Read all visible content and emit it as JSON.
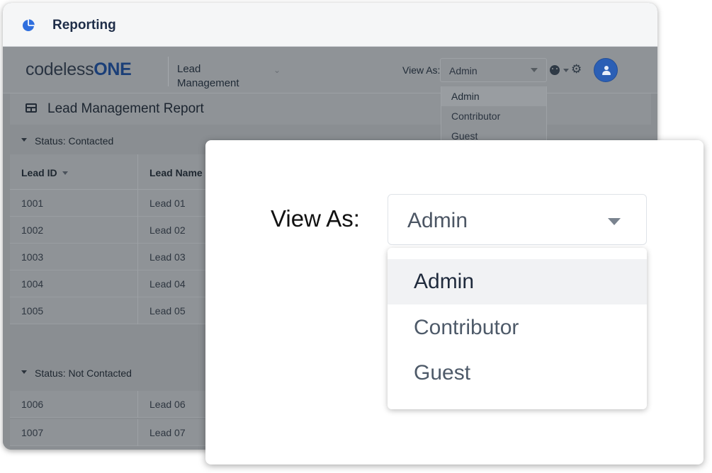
{
  "window": {
    "title": "Reporting",
    "app_icon": "pie-chart-icon"
  },
  "topbar": {
    "logo_main": "codeless",
    "logo_accent": "ONE",
    "app_selector": "Lead Management",
    "view_as_label": "View As:",
    "view_as_value": "Admin",
    "view_as_options": [
      "Admin",
      "Contributor",
      "Guest"
    ],
    "icons": [
      "smiley-icon",
      "gear-icon",
      "user-avatar-icon"
    ]
  },
  "report": {
    "title": "Lead Management Report",
    "columns": [
      "Lead ID",
      "Lead Name"
    ],
    "groups": [
      {
        "label": "Status: Contacted",
        "rows": [
          {
            "id": "1001",
            "name": "Lead 01"
          },
          {
            "id": "1002",
            "name": "Lead 02"
          },
          {
            "id": "1003",
            "name": "Lead 03"
          },
          {
            "id": "1004",
            "name": "Lead 04"
          },
          {
            "id": "1005",
            "name": "Lead 05"
          }
        ]
      },
      {
        "label": "Status: Not Contacted",
        "rows": [
          {
            "id": "1006",
            "name": "Lead 06"
          },
          {
            "id": "1007",
            "name": "Lead 07"
          }
        ]
      }
    ]
  },
  "zoom": {
    "view_as_label": "View As:",
    "selected": "Admin",
    "options": [
      "Admin",
      "Contributor",
      "Guest"
    ]
  },
  "colors": {
    "accent": "#2b5fb5",
    "title_text": "#1e2d48",
    "overlay": "#8f9397"
  }
}
